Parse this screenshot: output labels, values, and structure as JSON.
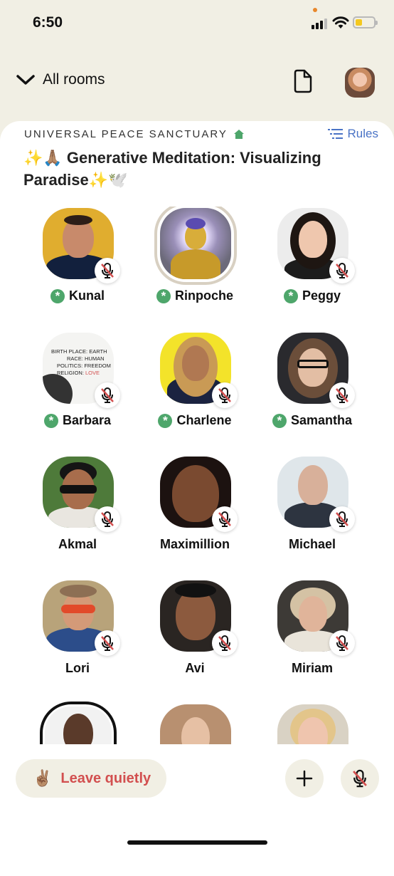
{
  "status": {
    "time": "6:50"
  },
  "header": {
    "back_label": "All rooms",
    "doc_icon": "document-icon",
    "profile_icon": "avatar"
  },
  "room": {
    "club_name": "UNIVERSAL PEACE SANCTUARY",
    "rules_label": "Rules",
    "title": "✨🙏🏽 Generative Meditation: Visualizing Paradise✨🕊️"
  },
  "speakers": [
    {
      "name": "Kunal",
      "moderator": true
    },
    {
      "name": "Rinpoche",
      "moderator": true
    },
    {
      "name": "Peggy",
      "moderator": true
    },
    {
      "name": "Barbara",
      "moderator": true
    },
    {
      "name": "Charlene",
      "moderator": true
    },
    {
      "name": "Samantha",
      "moderator": true
    },
    {
      "name": "Akmal",
      "moderator": false
    },
    {
      "name": "Maximillion",
      "moderator": false
    },
    {
      "name": "Michael",
      "moderator": false
    },
    {
      "name": "Lori",
      "moderator": false
    },
    {
      "name": "Avi",
      "moderator": false
    },
    {
      "name": "Miriam",
      "moderator": false
    }
  ],
  "barbara_avatar_text": {
    "line1": "BIRTH PLACE: EARTH",
    "line2": "RACE: HUMAN",
    "line3": "POLITICS: FREEDOM",
    "line4_prefix": "RELIGION: ",
    "line4_accent": "LOVE"
  },
  "bottom": {
    "leave_emoji": "✌🏽",
    "leave_label": "Leave quietly"
  },
  "colors": {
    "leave": "#d24f4f",
    "rules": "#4a73c6",
    "moderator": "#4ea66b",
    "background": "#f1efe4"
  }
}
